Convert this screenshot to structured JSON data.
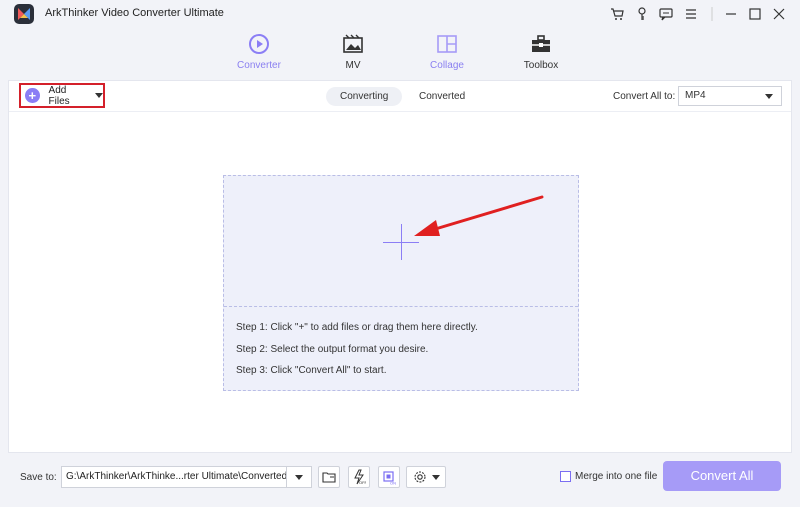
{
  "app": {
    "title": "ArkThinker Video Converter Ultimate"
  },
  "nav": [
    {
      "label": "Converter",
      "icon": "converter-icon"
    },
    {
      "label": "MV",
      "icon": "mv-icon"
    },
    {
      "label": "Collage",
      "icon": "collage-icon"
    },
    {
      "label": "Toolbox",
      "icon": "toolbox-icon"
    }
  ],
  "toolbar": {
    "add_files_label": "Add Files",
    "tabs": [
      {
        "label": "Converting"
      },
      {
        "label": "Converted"
      }
    ],
    "convert_all_to_label": "Convert All to:",
    "format_value": "MP4"
  },
  "dropzone": {
    "steps": [
      "Step 1: Click \"+\" to add files or drag them here directly.",
      "Step 2: Select the output format you desire.",
      "Step 3: Click \"Convert All\" to start."
    ]
  },
  "bottom": {
    "save_to_label": "Save to:",
    "save_path": "G:\\ArkThinker\\ArkThinke...rter Ultimate\\Converted",
    "merge_label": "Merge into one file",
    "convert_all_button": "Convert All"
  },
  "colors": {
    "accent": "#8b7ef5",
    "highlight_red": "#d4202a",
    "convert_button": "#a69bf7"
  }
}
